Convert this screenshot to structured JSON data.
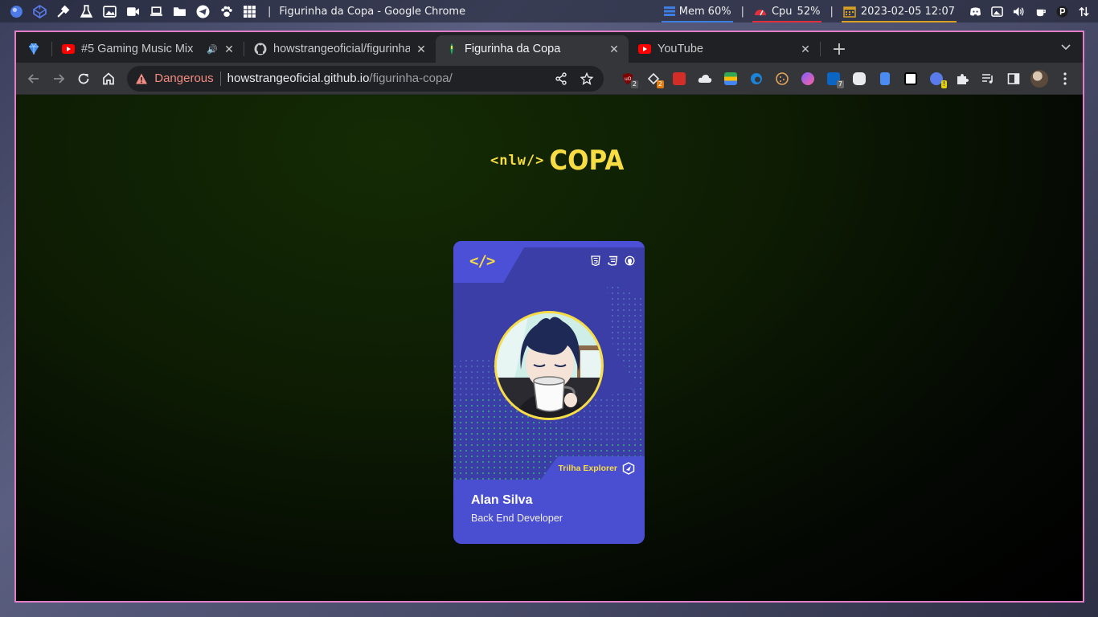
{
  "top_panel": {
    "window_title": "Figurinha da Copa - Google Chrome",
    "separator": "|",
    "launcher_icons": [
      "app-menu-icon",
      "codepen-icon",
      "color-picker-icon",
      "flask-icon",
      "image-viewer-icon",
      "video-camera-icon",
      "laptop-icon",
      "folder-icon",
      "telegram-icon",
      "paw-icon",
      "app-grid-icon"
    ],
    "memory": {
      "label": "Mem",
      "value": "60%"
    },
    "cpu": {
      "label": "Cpu",
      "value": "52%"
    },
    "datetime": "2023-02-05 12:07",
    "colors": {
      "mem_bar": "#3d7ee0",
      "cpu_bar": "#e0303b",
      "date_bar": "#d8a023"
    }
  },
  "browser": {
    "tabs": [
      {
        "title": "",
        "icon": "gem-icon",
        "pinned": true
      },
      {
        "title": "#5 Gaming Music Mix",
        "icon": "youtube-icon",
        "audio": true
      },
      {
        "title": "howstrangeoficial/figurinha-copa",
        "icon": "github-icon"
      },
      {
        "title": "Figurinha da Copa",
        "icon": "nlw-favicon-icon",
        "active": true
      },
      {
        "title": "YouTube",
        "icon": "youtube-icon"
      }
    ],
    "new_tab_label": "+",
    "omnibox": {
      "security_label": "Dangerous",
      "url_host": "howstrangeoficial.github.io",
      "url_path": "/figurinha-copa/"
    },
    "extension_badges": {
      "ublock": "2",
      "feedly": "2",
      "linkedin": "7",
      "notes": "!"
    }
  },
  "page": {
    "logo_tag": "<nlw/>",
    "logo_word": "COPA",
    "sticker": {
      "code_symbol": "</>",
      "trail": "Trilha Explorer",
      "name": "Alan Silva",
      "role": "Back End Developer"
    },
    "colors": {
      "yellow": "#f7dd43",
      "card_blue": "#4a4ed0",
      "card_dark_blue": "#3b3ea6",
      "accent_green": "#1bb562"
    }
  }
}
